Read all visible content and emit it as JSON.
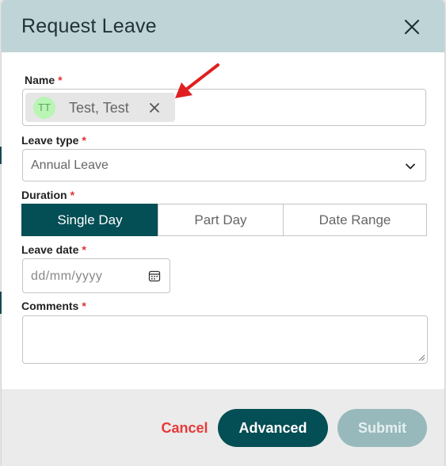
{
  "modal": {
    "title": "Request Leave"
  },
  "form": {
    "name": {
      "label": "Name",
      "required_mark": "*",
      "chip": {
        "initials": "TT",
        "text": "Test, Test"
      }
    },
    "leave_type": {
      "label": "Leave type",
      "required_mark": "*",
      "value": "Annual Leave"
    },
    "duration": {
      "label": "Duration",
      "required_mark": "*",
      "options": [
        "Single Day",
        "Part Day",
        "Date Range"
      ],
      "selected": "Single Day"
    },
    "leave_date": {
      "label": "Leave date",
      "required_mark": "*",
      "placeholder": "dd/mm/yyyy"
    },
    "comments": {
      "label": "Comments",
      "required_mark": "*"
    }
  },
  "footer": {
    "cancel_label": "Cancel",
    "advanced_label": "Advanced",
    "submit_label": "Submit"
  },
  "colors": {
    "header_bg": "#bfd4d6",
    "primary": "#044e55",
    "danger": "#e8393b",
    "disabled": "#97b9bc",
    "annotation_arrow": "#e02020"
  },
  "icons": [
    "close-icon",
    "chip-remove-icon",
    "chevron-down-icon",
    "calendar-icon",
    "annotation-arrow-icon"
  ]
}
